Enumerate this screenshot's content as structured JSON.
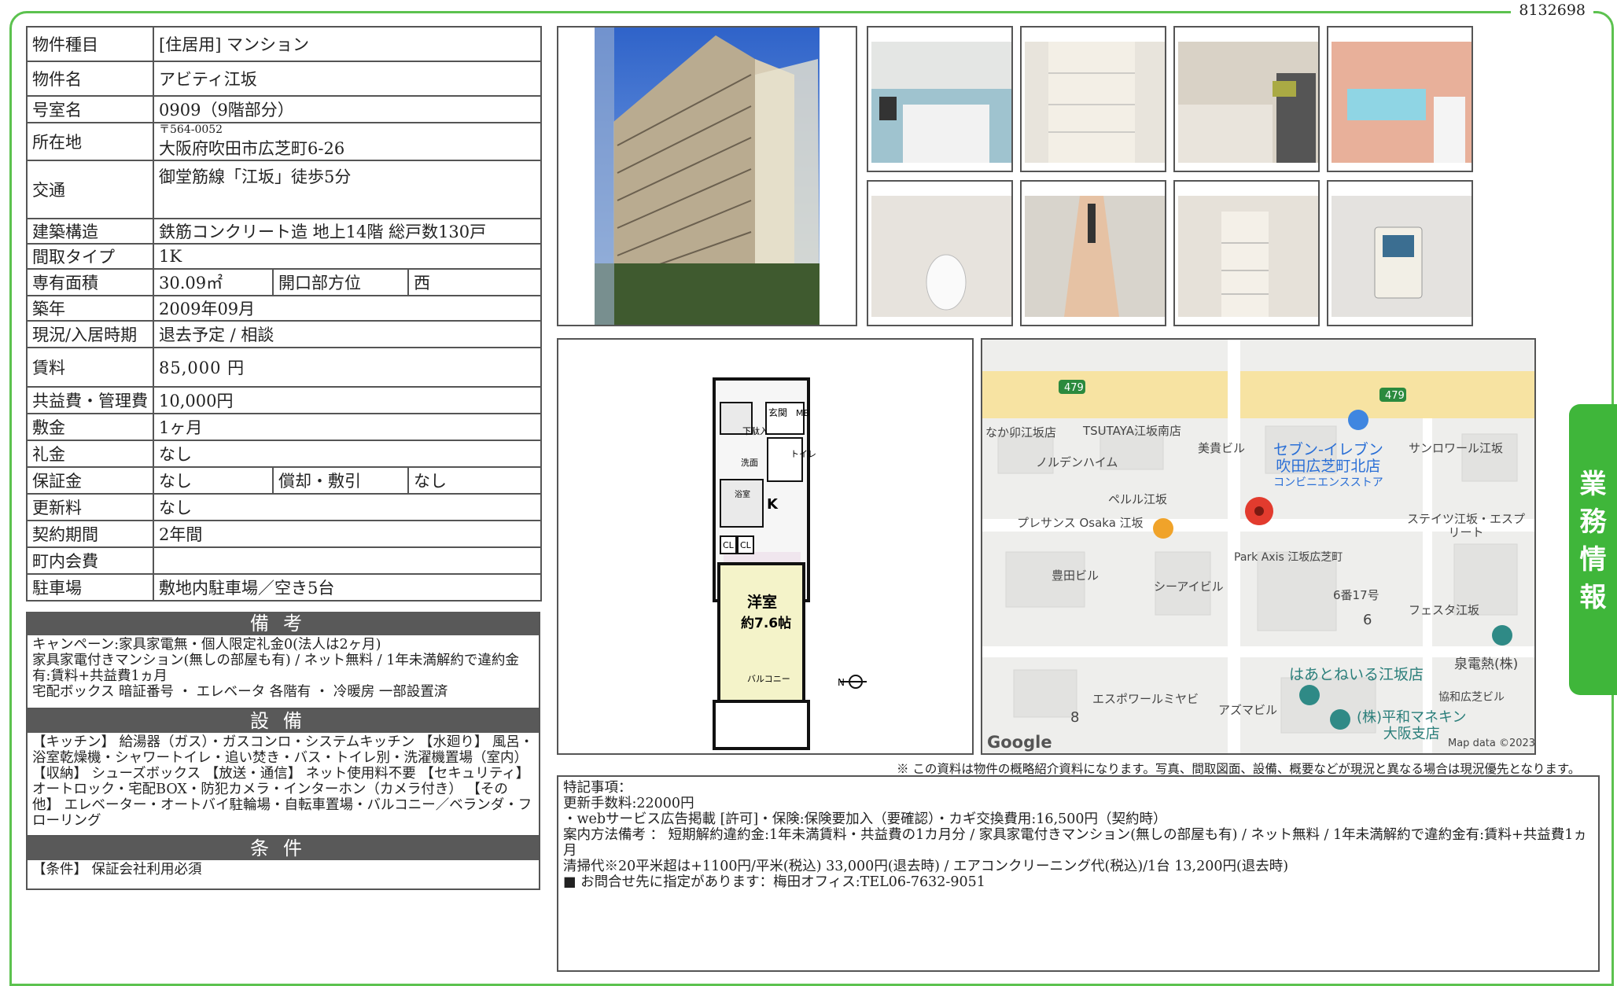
{
  "doc_id": "8132698",
  "rows": {
    "type_label": "物件種目",
    "type_value": "[住居用] マンション",
    "name_label": "物件名",
    "name_value": "アビティ江坂",
    "room_label": "号室名",
    "room_value": "0909（9階部分）",
    "addr_label": "所在地",
    "addr_zip": "〒564-0052",
    "addr_value": "大阪府吹田市広芝町6-26",
    "access_label": "交通",
    "access_value": "御堂筋線「江坂」徒歩5分",
    "structure_label": "建築構造",
    "structure_value": "鉄筋コンクリート造 地上14階 総戸数130戸",
    "layout_label": "間取タイプ",
    "layout_value": "1K",
    "area_label": "専有面積",
    "area_value": "30.09㎡",
    "dir_label": "開口部方位",
    "dir_value": "西",
    "built_label": "築年",
    "built_value": "2009年09月",
    "status_label": "現況/入居時期",
    "status_value": "退去予定 / 相談",
    "rent_label": "賃料",
    "rent_value": "85,000 円",
    "fee_label": "共益費・管理費",
    "fee_value": "10,000円",
    "deposit_label": "敷金",
    "deposit_value": "1ヶ月",
    "key_label": "礼金",
    "key_value": "なし",
    "guarantee_label": "保証金",
    "guarantee_value": "なし",
    "amort_label": "償却・敷引",
    "amort_value": "なし",
    "renewal_label": "更新料",
    "renewal_value": "なし",
    "term_label": "契約期間",
    "term_value": "2年間",
    "town_label": "町内会費",
    "town_value": "",
    "parking_label": "駐車場",
    "parking_value": "敷地内駐車場／空き5台"
  },
  "remarks": {
    "title": "備考",
    "text": "キャンペーン:家具家電無・個人限定礼金0(法人は2ヶ月)\n家具家電付きマンション(無しの部屋も有) / ネット無料 / 1年未満解約で違約金有:賃料+共益費1ヵ月\n宅配ボックス 暗証番号 ・ エレベータ 各階有 ・ 冷暖房 一部設置済"
  },
  "facilities": {
    "title": "設備",
    "text": "【キッチン】 給湯器（ガス）・ガスコンロ・システムキッチン 【水廻り】 風呂・浴室乾燥機・シャワートイレ・追い焚き・バス・トイレ別・洗濯機置場（室内） 【収納】 シューズボックス 【放送・通信】 ネット使用料不要 【セキュリティ】 オートロック・宅配BOX・防犯カメラ・インターホン（カメラ付き） 【その他】 エレベーター・オートバイ駐輪場・自転車置場・バルコニー／ベランダ・フローリング"
  },
  "conditions": {
    "title": "条件",
    "text": "【条件】 保証会社利用必須"
  },
  "floorplan": {
    "room": "洋室",
    "size": "約7.6帖",
    "kitchen": "K",
    "balcony": "バルコニー",
    "entrance": "玄関",
    "mb": "MB",
    "toilet": "トイレ",
    "wash": "洗面",
    "bath": "浴室",
    "cl": "CL",
    "shoes": "下駄入",
    "north": "N"
  },
  "map": {
    "labels": [
      "なか卯江坂店",
      "TSUTAYA江坂南店",
      "美貴ビル",
      "サンロワール江坂",
      "ノルデンハイム",
      "ペルル江坂",
      "プレサンス Osaka 江坂",
      "ステイツ江坂・エスプリート",
      "Park Axis 江坂広芝町",
      "豊田ビル",
      "シーアイビル",
      "6番17号",
      "フェスタ江坂",
      "エスポワールミヤビ",
      "アズマビル",
      "協和広芝ビル",
      "泉電熱(株)",
      "6",
      "8"
    ],
    "store_name": "セブン-イレブン",
    "store_line2": "吹田広芝町北店",
    "store_line3": "コンビニエンスストア",
    "place1": "はあとねいる江坂店",
    "place2_line1": "(株)平和マネキン",
    "place2_line2": "大阪支店",
    "route": "479",
    "google": "Google",
    "mapdata": "Map data ©2023"
  },
  "notice": "※ この資料は物件の概略紹介資料になります。写真、間取図面、設備、概要などが現況と異なる場合は現況優先となります。",
  "notes": [
    "特記事項：",
    "更新手数料:22000円",
    "・webサービス広告掲載 [許可]・保険:保険要加入（要確認）・カギ交換費用:16,500円（契約時）",
    "案内方法備考 ： 短期解約違約金:1年未満賃料・共益費の1カ月分 / 家具家電付きマンション(無しの部屋も有) / ネット無料 / 1年未満解約で違約金有:賃料+共益費1ヵ月",
    "清掃代※20平米超は+1100円/平米(税込) 33,000円(退去時) / エアコンクリーニング代(税込)/1台 13,200円(退去時)",
    "■ お問合せ先に指定があります：梅田オフィス:TEL06-7632-9051"
  ],
  "side_tab": [
    "業",
    "務",
    "情",
    "報"
  ]
}
